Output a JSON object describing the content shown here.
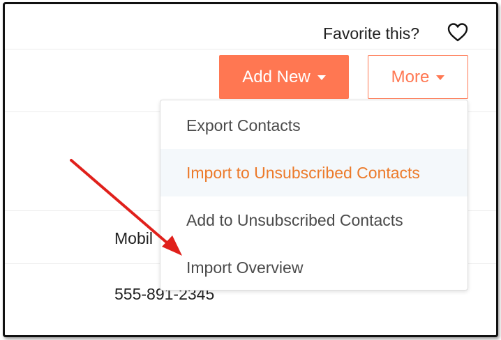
{
  "header": {
    "favorite_label": "Favorite this?",
    "favorite_icon": "heart-outline-icon"
  },
  "toolbar": {
    "add_new_label": "Add New",
    "more_label": "More",
    "accent_color": "#ff7752"
  },
  "table": {
    "column_header": "Mobil",
    "row_value": "555-891-2345"
  },
  "more_menu": {
    "items": [
      {
        "label": "Export Contacts",
        "highlighted": false
      },
      {
        "label": "Import to Unsubscribed Contacts",
        "highlighted": true
      },
      {
        "label": "Add to Unsubscribed Contacts",
        "highlighted": false
      },
      {
        "label": "Import Overview",
        "highlighted": false
      }
    ],
    "highlight_color": "#ec7a2a"
  },
  "annotation": {
    "arrow_color": "#e0201b"
  }
}
